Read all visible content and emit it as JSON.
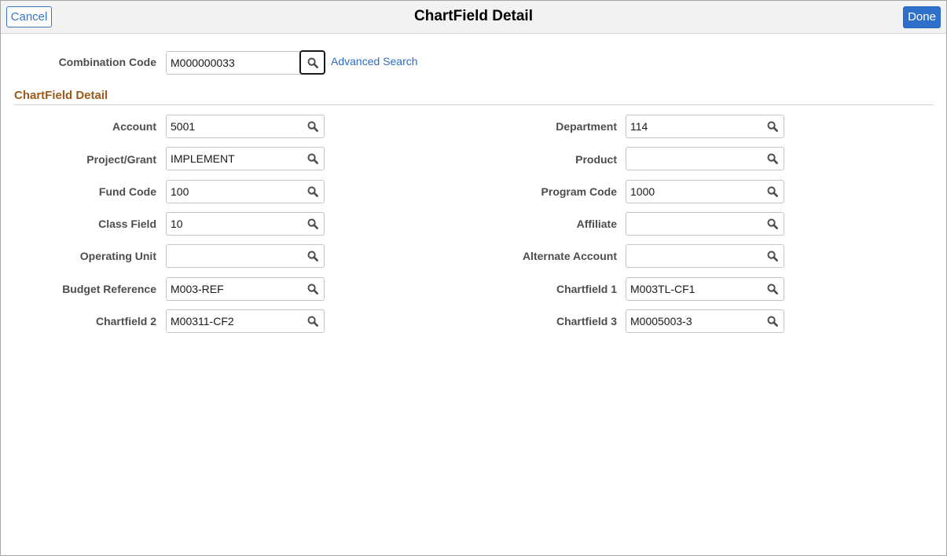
{
  "header": {
    "cancel_label": "Cancel",
    "title": "ChartField Detail",
    "done_label": "Done"
  },
  "combination": {
    "label": "Combination Code",
    "value": "M000000033",
    "advanced_search": "Advanced Search"
  },
  "section": {
    "title": "ChartField Detail"
  },
  "left_fields": [
    {
      "label": "Account",
      "value": "5001"
    },
    {
      "label": "Project/Grant",
      "value": "IMPLEMENT"
    },
    {
      "label": "Fund Code",
      "value": "100"
    },
    {
      "label": "Class Field",
      "value": "10"
    },
    {
      "label": "Operating Unit",
      "value": ""
    },
    {
      "label": "Budget Reference",
      "value": "M003-REF"
    },
    {
      "label": "Chartfield 2",
      "value": "M00311-CF2"
    }
  ],
  "right_fields": [
    {
      "label": "Department",
      "value": "114"
    },
    {
      "label": "Product",
      "value": ""
    },
    {
      "label": "Program Code",
      "value": "1000"
    },
    {
      "label": "Affiliate",
      "value": ""
    },
    {
      "label": "Alternate Account",
      "value": ""
    },
    {
      "label": "Chartfield 1",
      "value": "M003TL-CF1"
    },
    {
      "label": "Chartfield 3",
      "value": "M0005003-3"
    }
  ],
  "icons": {
    "lookup": "search-icon"
  }
}
